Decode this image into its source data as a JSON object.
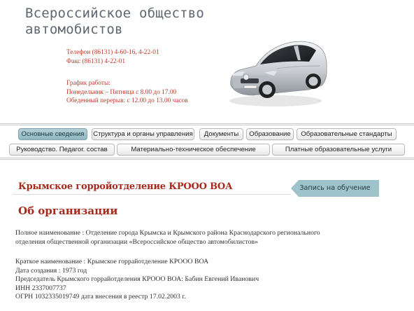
{
  "header": {
    "site_title_line1": "Всероссийское общество",
    "site_title_line2": "автомобистов",
    "phone": "Телефон (86131) 4-60-16, 4-22-01",
    "fax": "Факс (86131) 4-22-01",
    "schedule_label": "График работы:",
    "schedule_hours": "Понедельник – Пятница  с 8.00 до 17.00",
    "lunch_break": "Обеденный перерыв: с 12.00 до 13.00 часов"
  },
  "nav": {
    "row1": [
      "Основные сведения",
      "Структура и органы управления",
      "Документы",
      "Образование",
      "Образовательные стандарты"
    ],
    "row2": [
      "Руководство. Педагог. состав",
      "Материально-техническое обеспечение",
      "Платные образовательные услуги"
    ],
    "active": "Основные сведения"
  },
  "main": {
    "subtitle": "Крымское горройотделение КРООО ВОА",
    "apply_button": "Запись на обучение",
    "about_title": "Об организации",
    "full_name_line1": "Полное наименование : Отделение города Крымска и  Крымского района Краснодарского регионального",
    "full_name_line2": "отделения общественной организации «Всероссийское общество автомобилистов»",
    "short_name": "Краткое наименование : Крымское горрайотделение КРООО ВОА",
    "created": "Дата создания : 1973 год",
    "chairman": "Председатель Крымского горрайотделения КРООО ВОА:   Бабин Евгений Иванович",
    "inn": "ИНН 2337007737",
    "ogrn": "ОГРН 1032335019749 дата внесения в реестр 17.02.2003 г."
  },
  "colors": {
    "accent_red": "#a8291c",
    "contact_red": "#c0392b",
    "nav_active": "#9fc3ca",
    "title_gray": "#5f6770"
  }
}
